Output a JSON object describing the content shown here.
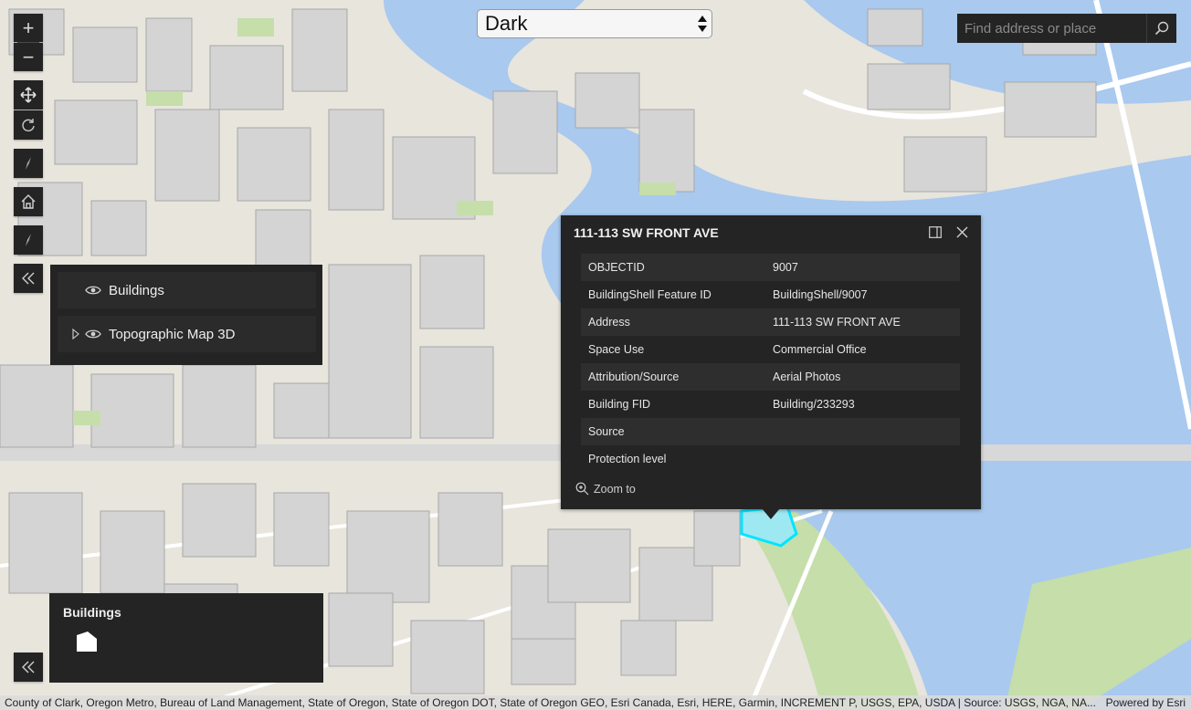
{
  "basemap": {
    "selected": "Dark"
  },
  "search": {
    "placeholder": "Find address or place"
  },
  "nav": {
    "zoom_in": "+",
    "zoom_out": "−"
  },
  "layer_list": {
    "items": [
      {
        "label": "Buildings",
        "expandable": false
      },
      {
        "label": "Topographic Map 3D",
        "expandable": true
      }
    ]
  },
  "popup": {
    "title": "111-113 SW FRONT AVE",
    "fields": [
      {
        "name": "OBJECTID",
        "value": "9007"
      },
      {
        "name": "BuildingShell Feature ID",
        "value": "BuildingShell/9007"
      },
      {
        "name": "Address",
        "value": "111-113 SW FRONT AVE"
      },
      {
        "name": "Space Use",
        "value": "Commercial Office"
      },
      {
        "name": "Attribution/Source",
        "value": "Aerial Photos"
      },
      {
        "name": "Building FID",
        "value": "Building/233293"
      },
      {
        "name": "Source",
        "value": ""
      },
      {
        "name": "Protection level",
        "value": ""
      }
    ],
    "zoom_to": "Zoom to"
  },
  "legend": {
    "title": "Buildings"
  },
  "attribution": {
    "sources": "County of Clark, Oregon Metro, Bureau of Land Management, State of Oregon, State of Oregon DOT, State of Oregon GEO, Esri Canada, Esri, HERE, Garmin, INCREMENT P, USGS, EPA, USDA | Source: USGS, NGA, NA...",
    "powered_by": "Powered by Esri"
  },
  "colors": {
    "panel": "#242424",
    "river": "#a9c9ee",
    "ground": "#e9e6df",
    "building": "#d4d4d4",
    "park": "#c5deaa",
    "highlight": "#00ffff"
  }
}
